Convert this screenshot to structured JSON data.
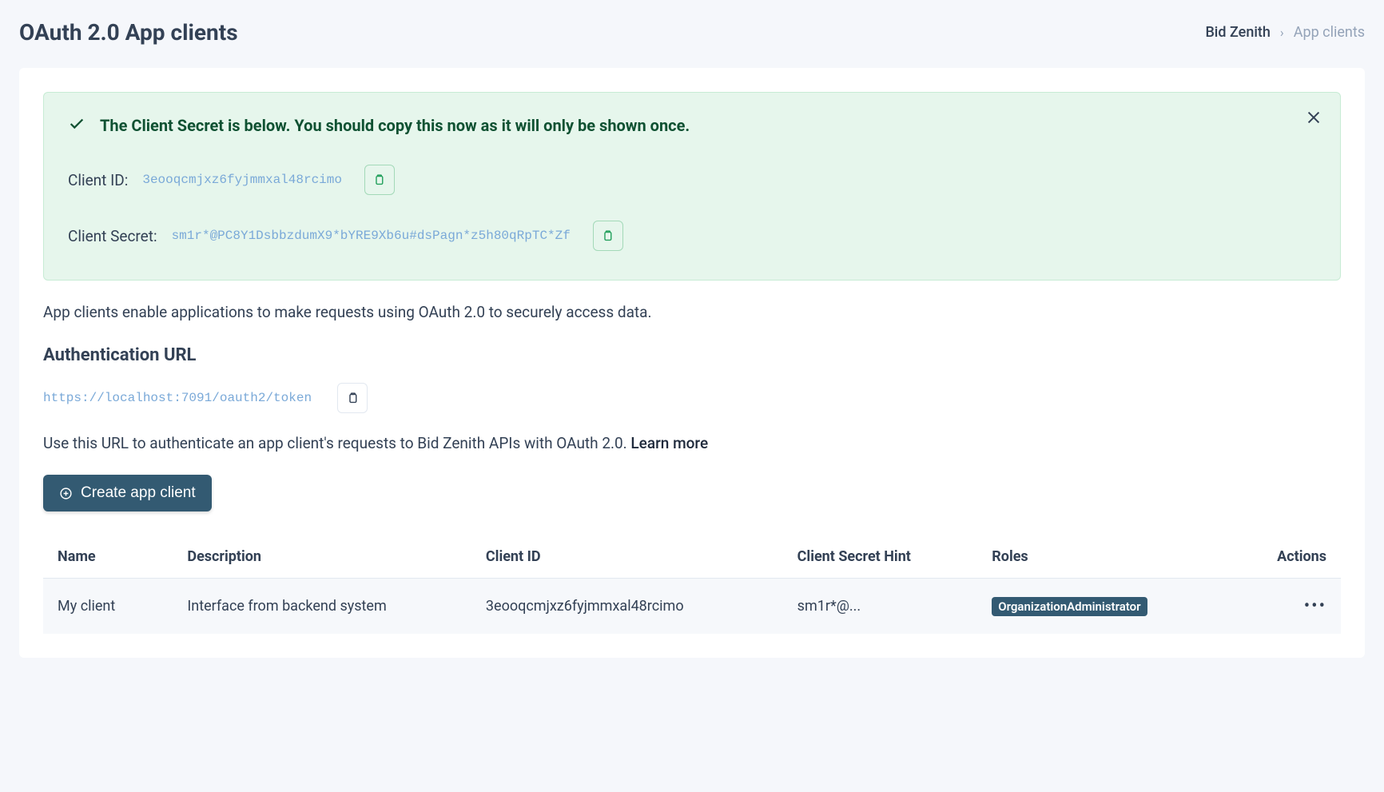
{
  "header": {
    "title": "OAuth 2.0 App clients"
  },
  "breadcrumb": {
    "parent": "Bid Zenith",
    "current": "App clients"
  },
  "alert": {
    "title": "The Client Secret is below. You should copy this now as it will only be shown once.",
    "client_id_label": "Client ID:",
    "client_id_value": "3eooqcmjxz6fyjmmxal48rcimo",
    "client_secret_label": "Client Secret:",
    "client_secret_value": "sm1r*@PC8Y1DsbbzdumX9*bYRE9Xb6u#dsPagn*z5h80qRpTC*Zf"
  },
  "description": "App clients enable applications to make requests using OAuth 2.0 to securely access data.",
  "auth_section": {
    "title": "Authentication URL",
    "url": "https://localhost:7091/oauth2/token",
    "help_text": "Use this URL to authenticate an app client's requests to Bid Zenith APIs with OAuth 2.0. ",
    "learn_more": "Learn more"
  },
  "create_button": "Create app client",
  "table": {
    "headers": {
      "name": "Name",
      "description": "Description",
      "client_id": "Client ID",
      "secret_hint": "Client Secret Hint",
      "roles": "Roles",
      "actions": "Actions"
    },
    "rows": [
      {
        "name": "My client",
        "description": "Interface from backend system",
        "client_id": "3eooqcmjxz6fyjmmxal48rcimo",
        "secret_hint": "sm1r*@...",
        "role_badge": "OrganizationAdministrator"
      }
    ]
  }
}
